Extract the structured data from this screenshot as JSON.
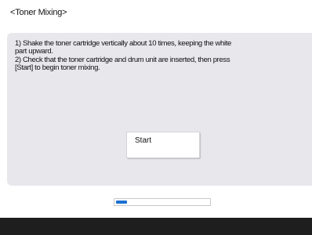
{
  "header": {
    "title": "<Toner Mixing>"
  },
  "panel": {
    "instruction_1_line_1": "1) Shake the toner cartridge vertically about 10 times, keeping the white",
    "instruction_1_line_2": "part upward.",
    "instruction_2_line_1": "2) Check that the toner cartridge and drum unit are inserted, then press",
    "instruction_2_line_2": "[Start] to begin toner mixing.",
    "start_button_label": "Start"
  },
  "progress": {
    "value_fraction": 0.12,
    "fill_color": "#1c6fd1"
  },
  "colors": {
    "panel_background": "#e7e7ec",
    "bottom_bar": "#1e1e1e"
  }
}
